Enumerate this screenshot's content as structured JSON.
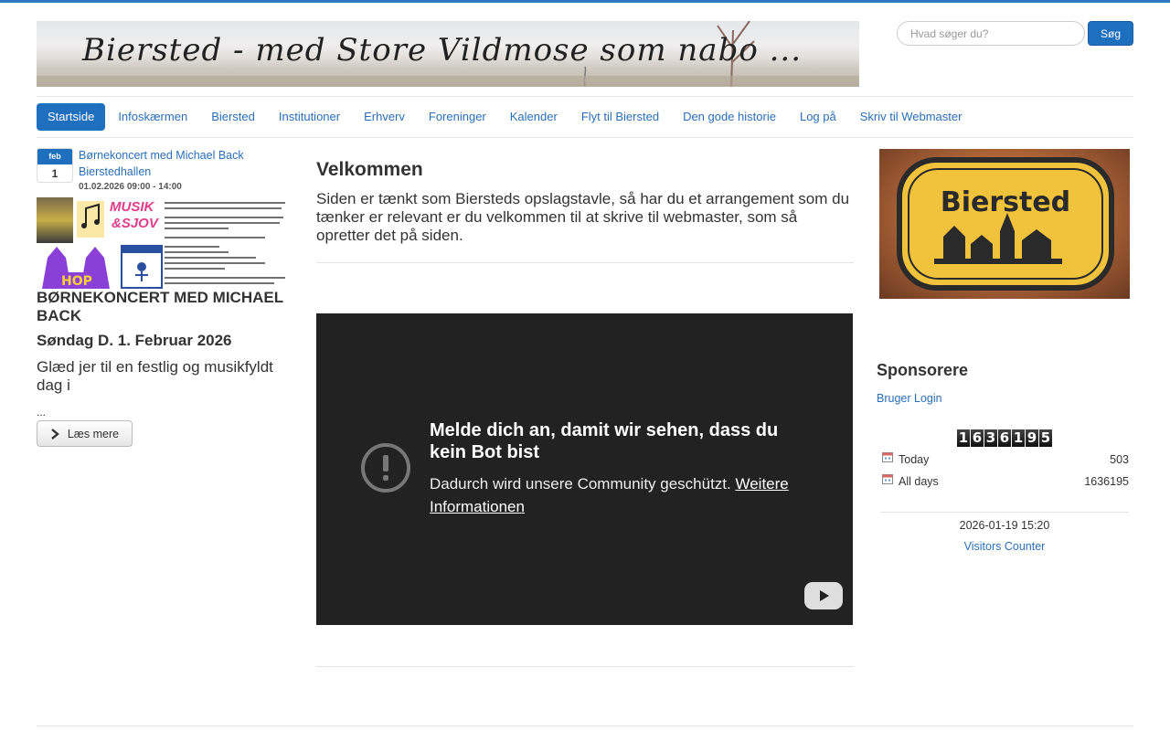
{
  "banner": {
    "title": "Biersted - med Store Vildmose som nabo ..."
  },
  "search": {
    "placeholder": "Hvad søger du?",
    "button_label": "Søg"
  },
  "nav": {
    "items": [
      {
        "label": "Startside",
        "active": true
      },
      {
        "label": "Infoskærmen"
      },
      {
        "label": "Biersted"
      },
      {
        "label": "Institutioner"
      },
      {
        "label": "Erhverv"
      },
      {
        "label": "Foreninger"
      },
      {
        "label": "Kalender"
      },
      {
        "label": "Flyt til Biersted"
      },
      {
        "label": "Den gode historie"
      },
      {
        "label": "Log på"
      },
      {
        "label": "Skriv til Webmaster"
      }
    ]
  },
  "event": {
    "month": "feb",
    "day": "1",
    "title": "Børnekoncert med Michael Back",
    "location": "Bierstedhallen",
    "time": "01.02.2026 09:00 - 14:00",
    "headline": "Børnekoncert med Michael Back",
    "subhead": "Søndag D. 1. Februar 2026",
    "teaser": "Glæd jer til en festlig og musikfyldt dag i",
    "ellipsis": "...",
    "read_more": "Læs mere",
    "poster": {
      "logo_line1": "MUSIK",
      "logo_line2": "&SJOV"
    }
  },
  "main": {
    "title": "Velkommen",
    "text": "Siden er tænkt som Biersteds opslagstavle, så har du et arrangement som du tænker er relevant er du velkommen til at skrive til webmaster, som så opretter det på siden."
  },
  "video": {
    "title": "Melde dich an, damit wir sehen, dass du kein Bot bist",
    "desc": "Dadurch wird unsere Community geschützt.",
    "link": "Weitere Informationen"
  },
  "sidebar": {
    "sign_text": "Biersted",
    "sponsors_title": "Sponsorere",
    "login_link": "Bruger Login",
    "counter_digits": [
      "1",
      "6",
      "3",
      "6",
      "1",
      "9",
      "5"
    ],
    "stats": [
      {
        "label": "Today",
        "value": "503"
      },
      {
        "label": "All days",
        "value": "1636195"
      }
    ],
    "timestamp": "2026-01-19 15:20",
    "visitors_link": "Visitors Counter"
  },
  "colors": {
    "accent": "#1f6fbf",
    "link": "#2a6fb8",
    "video_bg": "#222222"
  }
}
